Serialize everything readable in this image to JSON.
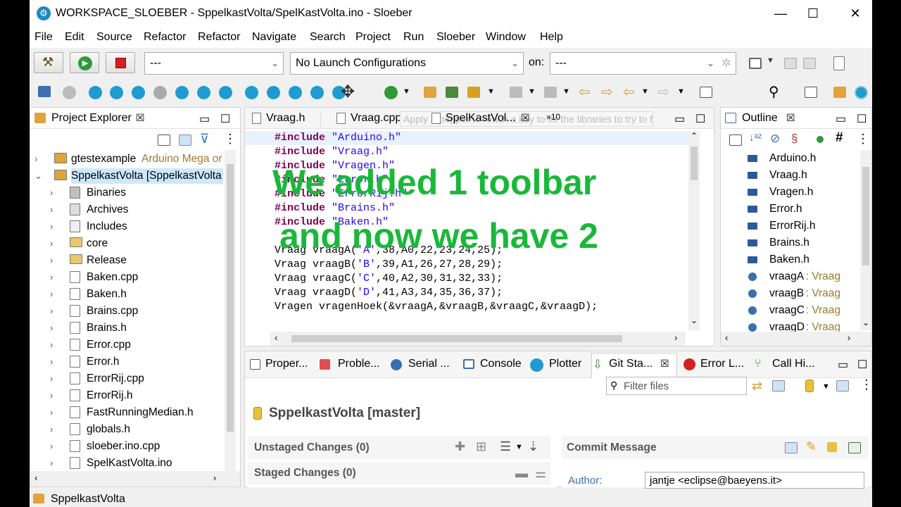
{
  "window": {
    "title": "WORKSPACE_SLOEBER - SppelkastVolta/SpelKastVolta.ino - Sloeber",
    "minimize": "—",
    "maximize": "☐",
    "close": "✕"
  },
  "menu": [
    "File",
    "Edit",
    "Source",
    "Refactor",
    "Refactor",
    "Navigate",
    "Search",
    "Project",
    "Run",
    "Sloeber",
    "Window",
    "Help"
  ],
  "toolbar": {
    "launch_mode": "---",
    "launch_config": "No Launch Configurations",
    "on_label": "on:",
    "target": "---"
  },
  "project_explorer": {
    "title": "Project Explorer",
    "items": [
      {
        "label": "gtestexample",
        "decoration": "Arduino Mega or"
      },
      {
        "label": "SppelkastVolta [SppelkastVolta r"
      },
      {
        "label": "Binaries"
      },
      {
        "label": "Archives"
      },
      {
        "label": "Includes"
      },
      {
        "label": "core"
      },
      {
        "label": "Release"
      },
      {
        "label": "Baken.cpp"
      },
      {
        "label": "Baken.h"
      },
      {
        "label": "Brains.cpp"
      },
      {
        "label": "Brains.h"
      },
      {
        "label": "Error.cpp"
      },
      {
        "label": "Error.h"
      },
      {
        "label": "ErrorRij.cpp"
      },
      {
        "label": "ErrorRij.h"
      },
      {
        "label": "FastRunningMedian.h"
      },
      {
        "label": "globals.h"
      },
      {
        "label": "sloeber.ino.cpp"
      },
      {
        "label": "SpelKastVolta.ino"
      }
    ]
  },
  "editor": {
    "tabs": [
      "Vraag.h",
      "Vraag.cpp",
      "SpelKastVol...",
      "10"
    ],
    "tooltip": "Apply a pepper to reach a key to fix the libraries to try to fix stuff.",
    "lines": [
      {
        "kw": "#include",
        "str": "\"Arduino.h\""
      },
      {
        "kw": "#include",
        "str": "\"Vraag.h\""
      },
      {
        "kw": "#include",
        "str": "\"Vragen.h\""
      },
      {
        "kw": "#include",
        "str": "\"Error.h\""
      },
      {
        "kw": "#include",
        "str": "\"ErrorRij.h\""
      },
      {
        "kw": "#include",
        "str": "\"Brains.h\""
      },
      {
        "kw": "#include",
        "str": "\"Baken.h\""
      },
      {
        "plain": ""
      },
      {
        "plain": "Vraag vraagA(",
        "str": "'A'",
        "rest": ",38,A0,22,23,24,25);"
      },
      {
        "plain": "Vraag vraagB(",
        "str": "'B'",
        "rest": ",39,A1,26,27,28,29);"
      },
      {
        "plain": "Vraag vraagC(",
        "str": "'C'",
        "rest": ",40,A2,30,31,32,33);"
      },
      {
        "plain": "Vraag vraagD(",
        "str": "'D'",
        "rest": ",41,A3,34,35,36,37);"
      },
      {
        "plain": "Vragen vragenHoek(&vraagA,&vraagB,&vraagC,&vraagD);"
      }
    ]
  },
  "overlay": {
    "line1": "We added 1 toolbar",
    "line2": "and now we have 2"
  },
  "outline": {
    "title": "Outline",
    "items": [
      {
        "label": "Arduino.h",
        "kind": "include"
      },
      {
        "label": "Vraag.h",
        "kind": "include"
      },
      {
        "label": "Vragen.h",
        "kind": "include"
      },
      {
        "label": "Error.h",
        "kind": "include"
      },
      {
        "label": "ErrorRij.h",
        "kind": "include"
      },
      {
        "label": "Brains.h",
        "kind": "include"
      },
      {
        "label": "Baken.h",
        "kind": "include"
      },
      {
        "label": "vraagA",
        "type": " : Vraag",
        "kind": "var"
      },
      {
        "label": "vraagB",
        "type": " : Vraag",
        "kind": "var"
      },
      {
        "label": "vraagC",
        "type": " : Vraag",
        "kind": "var"
      },
      {
        "label": "vraagD",
        "type": " : Vraag",
        "kind": "var"
      }
    ]
  },
  "bottom_tabs": [
    "Proper...",
    "Proble...",
    "Serial ...",
    "Console",
    "Plotter",
    "Git Sta...",
    "Error L...",
    "Call Hi..."
  ],
  "git_staging": {
    "filter_placeholder": "Filter files",
    "repo": "SppelkastVolta [master]",
    "unstaged": "Unstaged Changes (0)",
    "staged": "Staged Changes (0)",
    "commit_message": "Commit Message",
    "author_label": "Author:",
    "author_value": "jantje <eclipse@baeyens.it>"
  },
  "status_bar": "SppelkastVolta",
  "colors": {
    "overlay": "#19b83a",
    "keyword": "#7f0055",
    "string": "#2a00ff"
  }
}
